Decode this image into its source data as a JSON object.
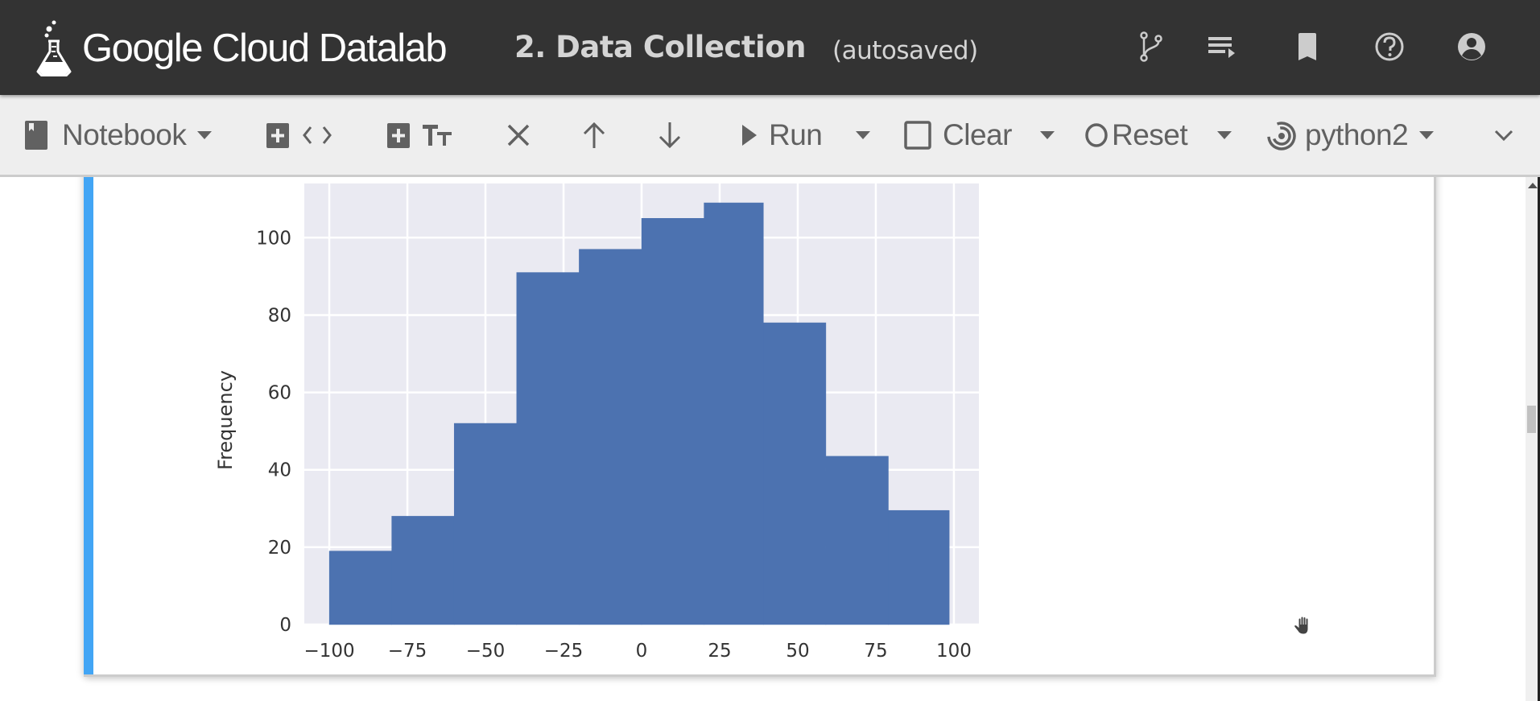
{
  "header": {
    "app_name": "Google Cloud Datalab",
    "notebook_title": "2. Data Collection",
    "save_status": "(autosaved)",
    "icons": [
      "git-branch-icon",
      "playlist-icon",
      "bookmark-icon",
      "help-icon",
      "account-icon"
    ]
  },
  "toolbar": {
    "notebook_label": "Notebook",
    "add_code_icon": "code-brackets-icon",
    "add_markdown_icon": "text-format-icon",
    "delete_icon": "close-icon",
    "move_up_icon": "arrow-up-icon",
    "move_down_icon": "arrow-down-icon",
    "run_label": "Run",
    "clear_label": "Clear",
    "reset_label": "Reset",
    "kernel_label": "python2",
    "collapse_icon": "chevron-down-icon"
  },
  "colors": {
    "header_bg": "#333333",
    "toolbar_bg": "#eeeeee",
    "cell_marker": "#42a5f5",
    "bar_fill": "#4c72b0",
    "plot_bg": "#eaeaf2"
  },
  "chart_data": {
    "type": "bar",
    "subtype": "histogram",
    "title": "",
    "xlabel": "",
    "ylabel": "Frequency",
    "bin_edges": [
      -100,
      -80,
      -60,
      -40,
      -20,
      0,
      20,
      39,
      59,
      79,
      98.5
    ],
    "values": [
      19,
      28,
      52,
      91,
      97,
      105,
      109,
      78,
      43.5,
      29.5
    ],
    "xlim": [
      -108,
      108
    ],
    "ylim": [
      0,
      114
    ],
    "xticks": [
      -100,
      -75,
      -50,
      -25,
      0,
      25,
      50,
      75,
      100
    ],
    "xtick_labels": [
      "−100",
      "−75",
      "−50",
      "−25",
      "0",
      "25",
      "50",
      "75",
      "100"
    ],
    "yticks": [
      0,
      20,
      40,
      60,
      80,
      100
    ],
    "ytick_labels": [
      "0",
      "20",
      "40",
      "60",
      "80",
      "100"
    ],
    "grid": true,
    "legend": "none",
    "style": "seaborn-darkgrid"
  }
}
